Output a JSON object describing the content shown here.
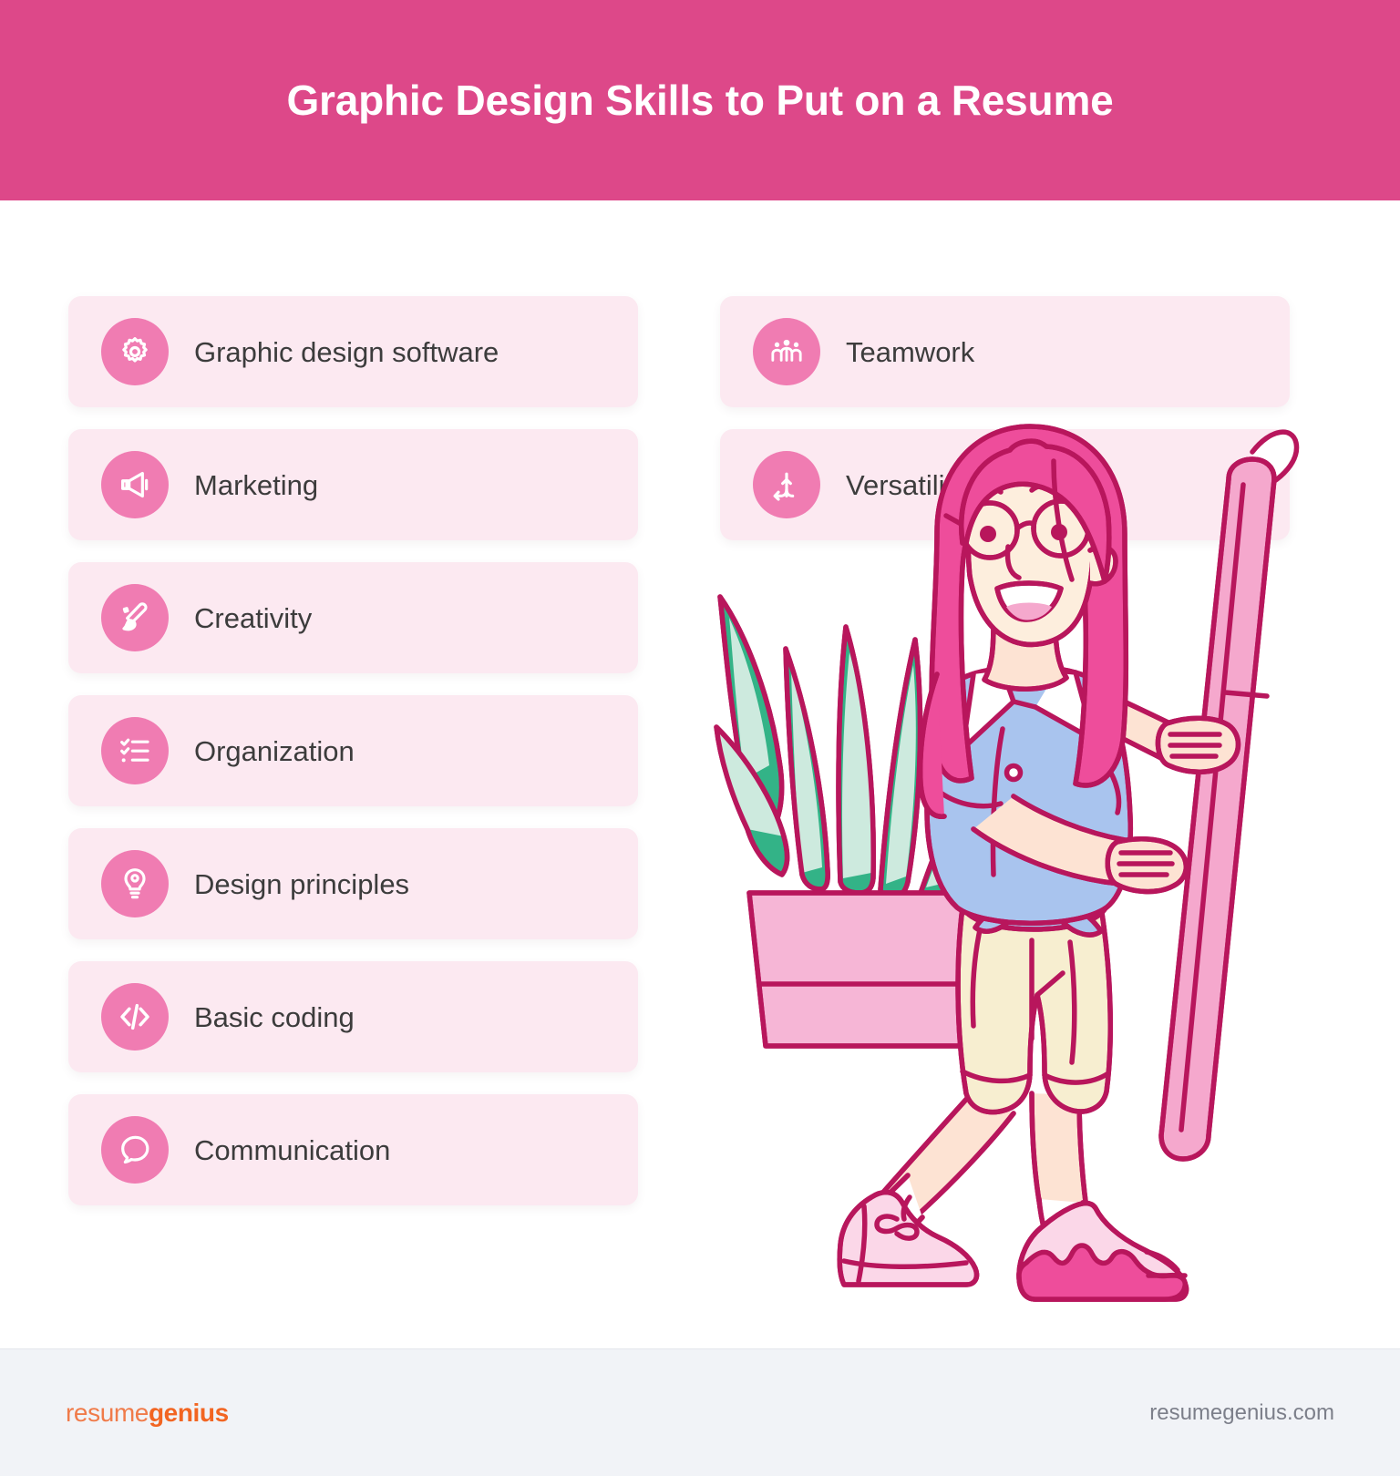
{
  "header": {
    "title": "Graphic Design Skills to Put on a Resume",
    "background_color": "#dd4889",
    "text_color": "#ffffff"
  },
  "theme": {
    "card_bg": "#fce9f1",
    "icon_circle": "#f07cb2",
    "label_color": "#3c3c3c",
    "page_bg": "#ffffff",
    "footer_bg": "#f1f3f7",
    "illustration_outline": "#b8165c",
    "illustration_hair": "#ee4d9b",
    "illustration_shirt": "#a9c4ee",
    "illustration_shorts": "#f7eed0",
    "illustration_skin": "#fde3d3",
    "illustration_tube": "#f5a8cd",
    "illustration_plant_green": "#33b387",
    "illustration_plant_light": "#cdeade",
    "illustration_pot": "#f6b6d6",
    "illustration_shoe_dark": "#ee4d9b"
  },
  "columns": {
    "left": [
      {
        "label": "Graphic design software",
        "icon": "gear-icon"
      },
      {
        "label": "Marketing",
        "icon": "megaphone-icon"
      },
      {
        "label": "Creativity",
        "icon": "paintbrush-icon"
      },
      {
        "label": "Organization",
        "icon": "checklist-icon"
      },
      {
        "label": "Design principles",
        "icon": "lightbulb-icon"
      },
      {
        "label": "Basic coding",
        "icon": "code-brackets-icon"
      },
      {
        "label": "Communication",
        "icon": "speech-bubble-icon"
      }
    ],
    "right": [
      {
        "label": "Teamwork",
        "icon": "people-group-icon"
      },
      {
        "label": "Versatility",
        "icon": "branching-arrow-icon"
      }
    ]
  },
  "illustration": {
    "description": "Woman with long pink hair and round glasses holding a large rolled poster tube, standing beside a potted snake plant"
  },
  "footer": {
    "logo_part_one": "resume",
    "logo_part_two": "genius",
    "url": "resumegenius.com"
  }
}
